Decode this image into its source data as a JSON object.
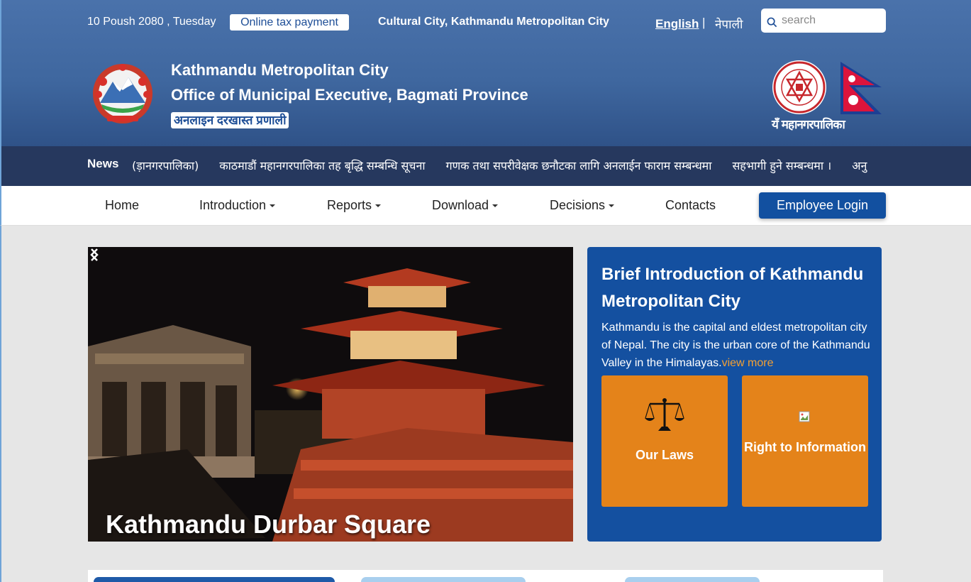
{
  "topbar": {
    "date": "10 Poush 2080 , Tuesday",
    "tax_button": "Online tax payment",
    "culture_text": "Cultural City, Kathmandu Metropolitan City",
    "lang_english": "English",
    "lang_separator": "|",
    "lang_nepali": "नेपाली",
    "search_placeholder": "search"
  },
  "header": {
    "title_line1": "Kathmandu Metropolitan City",
    "title_line2": "Office of Municipal Executive, Bagmati Province",
    "online_badge": "अनलाइन दरखास्त प्रणाली",
    "logo_text": "यँ महानगरपालिका",
    "seal_text": "Kathmandu Metropolitan City"
  },
  "news": {
    "label": "News",
    "items": [
      "(ड़ानगरपालिका)",
      "काठमाडौं महानगरपालिका तह बृद्धि सम्बन्धि सूचना",
      "गणक तथा सपरीवेक्षक छनौटका लागि अनलाईन फाराम सम्बन्धमा",
      "सहभागी हुने सम्बन्धमा ।",
      "अनु"
    ]
  },
  "nav": {
    "items": [
      "Home",
      "Introduction",
      "Reports",
      "Download",
      "Decisions",
      "Contacts"
    ],
    "login": "Employee Login"
  },
  "slider": {
    "caption": "Kathmandu Durbar Square"
  },
  "intro": {
    "title": "Brief Introduction of Kathmandu Metropolitan City",
    "text": "Kathmandu is the capital and eldest metropolitan city of Nepal. The city is the urban core of the Kathmandu Valley in the Himalayas.",
    "view_more": "view more",
    "cards": {
      "laws": "Our Laws",
      "rti": "Right to Information"
    }
  },
  "colors": {
    "header_blue": "#3f679f",
    "news_navy": "#26385e",
    "primary_blue": "#1450a0",
    "card_orange": "#e4831a",
    "link_orange": "#f3a033"
  },
  "icons": [
    "search-icon",
    "emblem-icon",
    "kmc-seal-icon",
    "nepal-flag-icon",
    "caret-down-icon",
    "chevron-left-icon",
    "chevron-right-icon",
    "scale-icon",
    "broken-image-icon"
  ]
}
